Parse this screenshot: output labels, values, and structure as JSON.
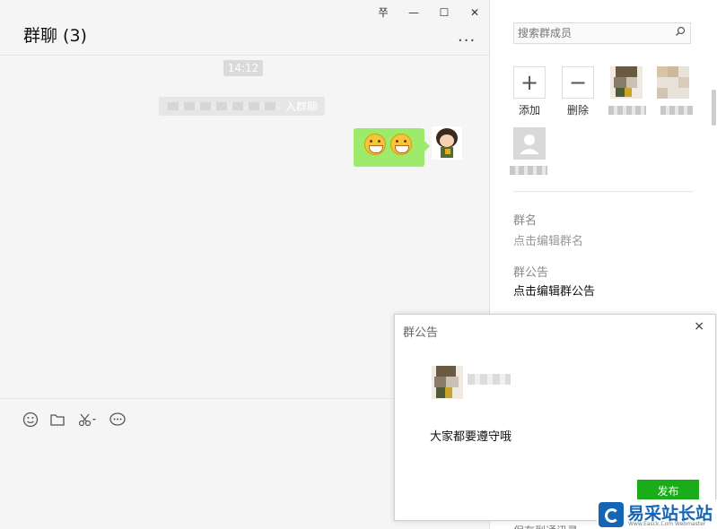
{
  "chat": {
    "title": "群聊 (3)",
    "window_buttons": [
      "쭈",
      "—",
      "☐",
      "✕"
    ],
    "more": "...",
    "time": "14:12",
    "system_msg": "入群聊",
    "toolbar_icons": [
      "emoji-icon",
      "folder-icon",
      "scissors-icon",
      "chat-bubble-icon"
    ]
  },
  "panel": {
    "search_placeholder": "搜索群成员",
    "add_label": "添加",
    "remove_label": "删除",
    "group_name_label": "群名",
    "group_name_value": "点击编辑群名",
    "notice_label": "群公告",
    "notice_value": "点击编辑群公告",
    "cut_text": "保存到通讯录"
  },
  "dialog": {
    "title": "群公告",
    "close": "×",
    "notice_text": "大家都要遵守哦",
    "publish": "发布"
  },
  "watermark": {
    "text": "易采站长站",
    "sub": "Www.Easck.Com Webmaster"
  },
  "colors": {
    "bubble": "#9eea6a",
    "publish_btn": "#1aad19",
    "watermark": "#1565b5"
  }
}
